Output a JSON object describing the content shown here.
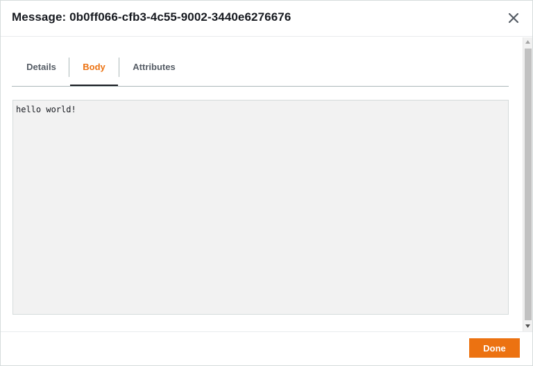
{
  "modal": {
    "title": "Message: 0b0ff066-cfb3-4c55-9002-3440e6276676",
    "close_icon": "close-icon"
  },
  "tabs": [
    {
      "label": "Details",
      "active": false
    },
    {
      "label": "Body",
      "active": true
    },
    {
      "label": "Attributes",
      "active": false
    }
  ],
  "body": {
    "text": "hello world!"
  },
  "footer": {
    "done_label": "Done"
  },
  "colors": {
    "accent": "#ec7211",
    "tab_text": "#545b64",
    "body_background": "#f2f2f2"
  }
}
